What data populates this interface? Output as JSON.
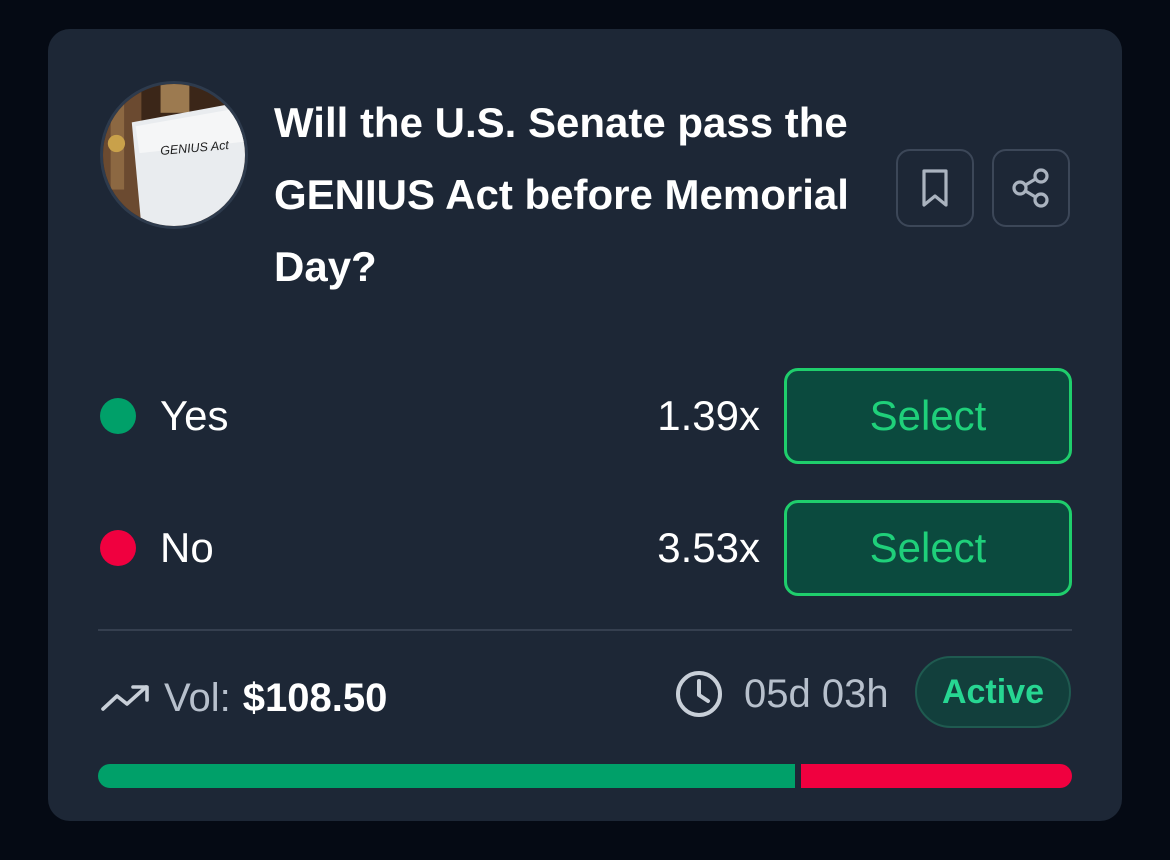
{
  "market": {
    "title": "Will the U.S. Senate pass the GENIUS Act before Memorial Day?",
    "image_text": "GENIUS Act"
  },
  "actions": {
    "bookmark_icon": "bookmark-icon",
    "share_icon": "share-icon"
  },
  "outcomes": [
    {
      "label": "Yes",
      "odds": "1.39x",
      "button_label": "Select",
      "color": "#00a069"
    },
    {
      "label": "No",
      "odds": "3.53x",
      "button_label": "Select",
      "color": "#f0003f"
    }
  ],
  "footer": {
    "volume_label": "Vol:",
    "volume_value": "$108.50",
    "time_remaining": "05d 03h",
    "status": "Active"
  },
  "probability": {
    "yes_fraction": 0.72,
    "no_fraction": 0.28
  },
  "colors": {
    "accent_green": "#1fce6c",
    "yes": "#00a069",
    "no": "#f0003f",
    "card_bg": "#1d2736"
  }
}
